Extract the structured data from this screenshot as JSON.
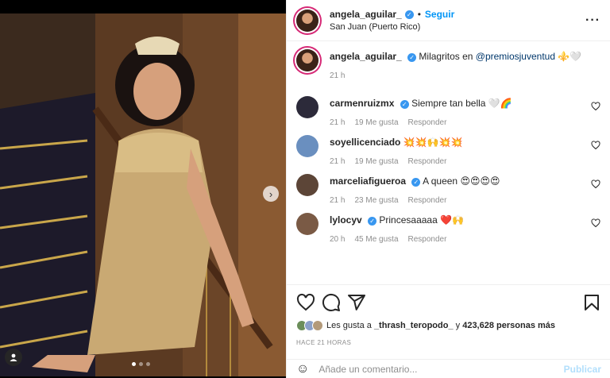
{
  "colors": {
    "accent": "#0095f6",
    "verified": "#3897f0",
    "like_red": "#ed4956"
  },
  "header": {
    "username": "angela_aguilar_",
    "separator": "•",
    "follow_label": "Seguir",
    "location": "San Juan (Puerto Rico)",
    "more_icon": "more-icon"
  },
  "caption": {
    "username": "angela_aguilar_",
    "text": "Milagritos en",
    "mention": "@premiosjuventud",
    "emoji": "⚜️🤍",
    "time": "21 h"
  },
  "comments": [
    {
      "username": "carmenruizmx",
      "verified": true,
      "text": "Siempre tan bella 🤍🌈",
      "time": "21 h",
      "likes": "19 Me gusta",
      "reply": "Responder",
      "avatar_color": "#2c2a3a"
    },
    {
      "username": "soyellicenciado",
      "verified": false,
      "text": "💥💥🙌💥💥",
      "time": "21 h",
      "likes": "19 Me gusta",
      "reply": "Responder",
      "avatar_color": "#6a8fbf"
    },
    {
      "username": "marceliafigueroa",
      "verified": true,
      "text": "A queen 😍😍😍😍",
      "time": "21 h",
      "likes": "23 Me gusta",
      "reply": "Responder",
      "avatar_color": "#5c4537"
    },
    {
      "username": "lylocyv",
      "verified": true,
      "text": "Princesaaaaa ❤️🙌",
      "time": "20 h",
      "likes": "45 Me gusta",
      "reply": "Responder",
      "avatar_color": "#7a5a45"
    }
  ],
  "actions": {
    "likes_prefix": "Les gusta a",
    "liker": "_thrash_teropodo_",
    "likes_mid": "y",
    "likes_count": "423,628 personas más",
    "time_ago": "HACE 21 HORAS"
  },
  "add_comment": {
    "placeholder": "Añade un comentario...",
    "publish_label": "Publicar"
  },
  "carousel": {
    "current": 1,
    "total": 3
  }
}
